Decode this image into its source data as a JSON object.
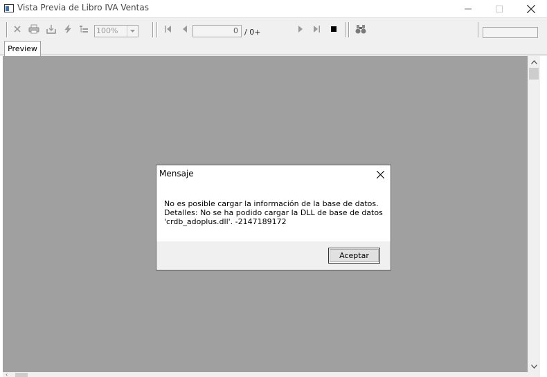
{
  "window": {
    "title": "Vista Previa de Libro IVA Ventas"
  },
  "toolbar": {
    "zoom_value": "100%",
    "page_current": "0",
    "page_total": "/ 0+"
  },
  "tabs": [
    {
      "label": "Preview"
    }
  ],
  "dialog": {
    "title": "Mensaje",
    "message_lines": [
      "No es posible cargar la información de la base de datos.",
      "Detalles: No se ha podido cargar la DLL de base de datos",
      "'crdb_adoplus.dll'. -2147189172"
    ],
    "ok_label": "Aceptar"
  },
  "colors": {
    "preview_background": "#a0a0a0",
    "toolbar_background": "#f0f0f0",
    "dialog_background": "#f0f0f0"
  }
}
